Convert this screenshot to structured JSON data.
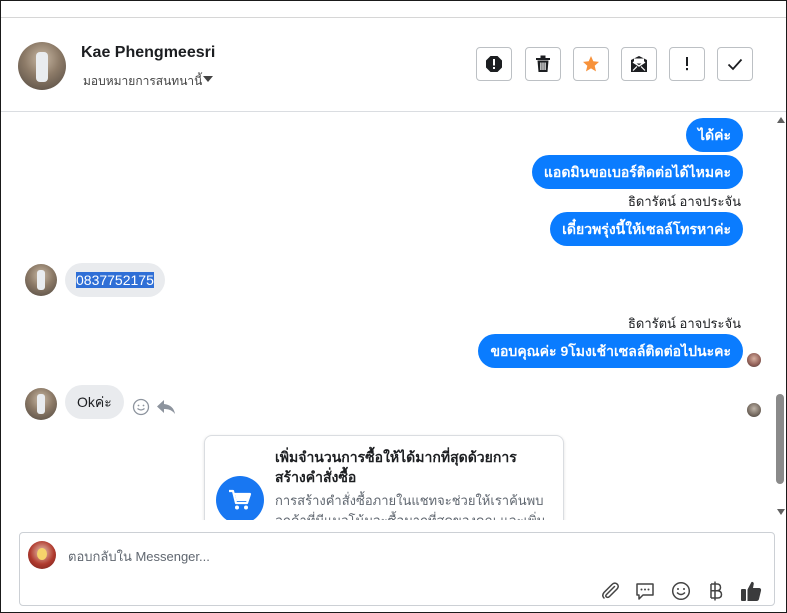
{
  "header": {
    "contact_name": "Kae Phengmeesri",
    "assign_label": "มอบหมายการสนทนานี้",
    "toolbar": [
      {
        "name": "mark-spam-button",
        "icon": "alert-octagon-icon"
      },
      {
        "name": "delete-button",
        "icon": "trash-icon"
      },
      {
        "name": "star-button",
        "icon": "star-icon"
      },
      {
        "name": "mark-unread-button",
        "icon": "envelope-icon"
      },
      {
        "name": "follow-up-button",
        "icon": "exclamation-icon"
      },
      {
        "name": "mark-done-button",
        "icon": "check-icon"
      }
    ],
    "star_color": "#f7923b"
  },
  "messages": {
    "m1": "ได้ค่ะ",
    "m2": "แอดมินขอเบอร์ติดต่อได้ไหมคะ",
    "m3_sender": "ธิดารัตน์ อาจประจัน",
    "m3": "เดี๋ยวพรุ่งนี้ให้เซลล์โทรหาค่ะ",
    "m4": "0837752175",
    "m5_sender": "ธิดารัตน์ อาจประจัน",
    "m5": "ขอบคุณค่ะ 9โมงเช้าเซลล์ติดต่อไปนะคะ",
    "m6": "Okค่ะ"
  },
  "card": {
    "title": "เพิ่มจำนวนการซื้อให้ได้มากที่สุดด้วยการสร้างคำสั่งซื้อ",
    "body": "การสร้างคำสั่งซื้อภายในแชทจะช่วยให้เราค้นพบลูกค้าที่มีแนวโน้มจะซื้อมากที่สุดของคุณ และเพิ่มการ"
  },
  "composer": {
    "placeholder": "ตอบกลับใน Messenger..."
  },
  "colors": {
    "outgoing_bubble": "#0a7cff",
    "incoming_bubble": "#e9ebee",
    "card_icon": "#1877f2"
  }
}
